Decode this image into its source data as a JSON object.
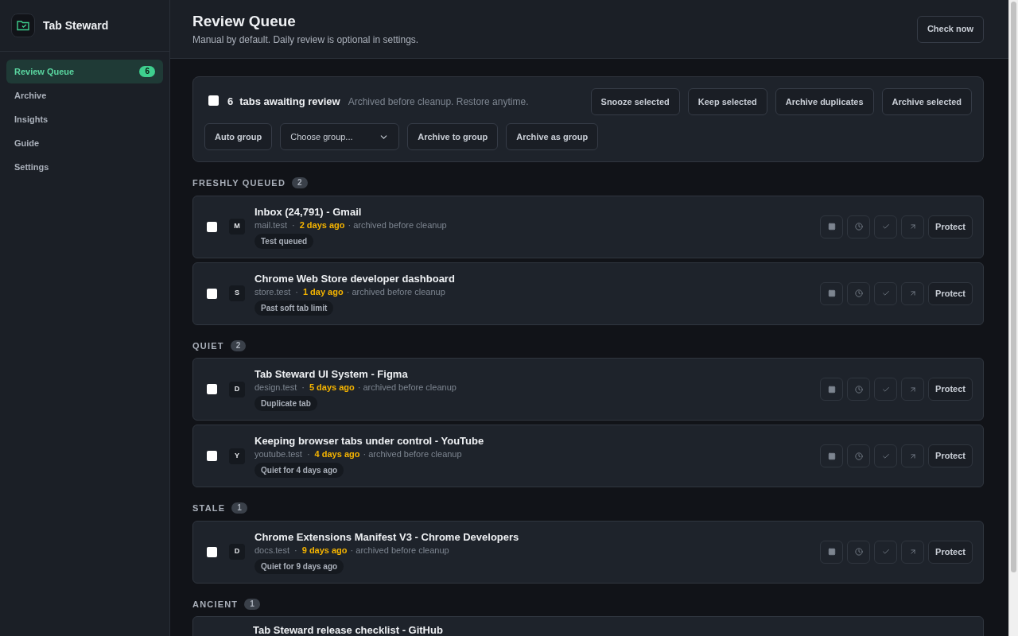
{
  "app": {
    "name": "Tab Steward"
  },
  "sidebar": {
    "items": [
      {
        "label": "Review Queue",
        "selected": true,
        "badge": "6"
      },
      {
        "label": "Archive",
        "selected": false
      },
      {
        "label": "Insights",
        "selected": false
      },
      {
        "label": "Guide",
        "selected": false
      },
      {
        "label": "Settings",
        "selected": false
      }
    ]
  },
  "header": {
    "title": "Review Queue",
    "subtitle": "Manual by default. Daily review is optional in settings.",
    "button": "Check now"
  },
  "toolbar": {
    "select_all_checked": false,
    "count": "6",
    "count_label": "tabs awaiting review",
    "note": "Archived before cleanup. Restore anytime.",
    "actions": [
      "Snooze selected",
      "Keep selected",
      "Archive duplicates",
      "Archive selected"
    ],
    "group_actions": [
      {
        "kind": "button",
        "label": "Auto group"
      },
      {
        "kind": "select",
        "placeholder": "Choose group..."
      },
      {
        "kind": "button",
        "label": "Archive to group"
      },
      {
        "kind": "button",
        "label": "Archive as group"
      }
    ]
  },
  "sections": [
    {
      "title": "FRESHLY QUEUED",
      "count": "2",
      "tabs": [
        {
          "kind": "full",
          "checked": false,
          "separator": "·",
          "letter": "M",
          "title": "Inbox (24,791) - Gmail",
          "domain": "mail.test",
          "age": "2 days ago",
          "note": "· archived before cleanup",
          "tag": "Test queued",
          "action": "Protect"
        },
        {
          "kind": "full",
          "checked": false,
          "separator": "·",
          "letter": "S",
          "title": "Chrome Web Store developer dashboard",
          "domain": "store.test",
          "age": "1 day ago",
          "note": "· archived before cleanup",
          "tag": "Past soft tab limit",
          "action": "Protect"
        }
      ]
    },
    {
      "title": "QUIET",
      "count": "2",
      "tabs": [
        {
          "kind": "full",
          "checked": false,
          "separator": "·",
          "letter": "D",
          "title": "Tab Steward UI System - Figma",
          "domain": "design.test",
          "age": "5 days ago",
          "note": "· archived before cleanup",
          "tag": "Duplicate tab",
          "action": "Protect"
        },
        {
          "kind": "full",
          "checked": false,
          "separator": "·",
          "letter": "Y",
          "title": "Keeping browser tabs under control - YouTube",
          "domain": "youtube.test",
          "age": "4 days ago",
          "note": "· archived before cleanup",
          "tag": "Quiet for 4 days ago",
          "action": "Protect"
        }
      ]
    },
    {
      "title": "STALE",
      "count": "1",
      "tabs": [
        {
          "kind": "full",
          "checked": false,
          "separator": "·",
          "letter": "D",
          "title": "Chrome Extensions Manifest V3 - Chrome Developers",
          "domain": "docs.test",
          "age": "9 days ago",
          "note": "· archived before cleanup",
          "tag": "Quiet for 9 days ago",
          "action": "Protect"
        }
      ]
    },
    {
      "title": "ANCIENT",
      "count": "1",
      "tabs": [
        {
          "kind": "title_only",
          "title": "Tab Steward release checklist - GitHub"
        }
      ]
    }
  ]
}
